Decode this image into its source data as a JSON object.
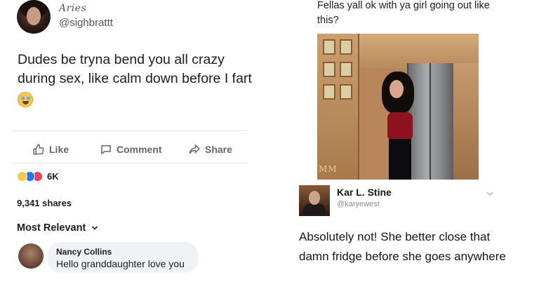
{
  "left_post": {
    "display_name": "Aries",
    "handle": "@sighbrattt",
    "text": "Dudes be tryna bend you all crazy during sex, like calm down before I fart",
    "emoji_icon": "rofl-emoji-icon",
    "actions": {
      "like": "Like",
      "comment": "Comment",
      "share": "Share"
    },
    "reactions": {
      "icons": [
        "haha-reaction-icon",
        "like-reaction-icon",
        "love-reaction-icon"
      ],
      "count": "6K"
    },
    "shares": "9,341 shares",
    "sort_label": "Most Relevant",
    "comment": {
      "author": "Nancy Collins",
      "text": "Hello granddaughter love you"
    }
  },
  "right_post": {
    "caption": "Fellas yall ok with ya girl going out like this?",
    "photo_watermark": "MM",
    "reply": {
      "name": "Kar L. Stine",
      "handle": "@karyewest",
      "text": "Absolutely not! She better close that damn fridge before she goes anywhere"
    }
  },
  "colors": {
    "fb_gray_text": "#65676b",
    "comment_bubble": "#f0f2f5",
    "like_blue": "#2078f4",
    "love_red": "#f33e58",
    "haha_yellow": "#f7c948"
  }
}
